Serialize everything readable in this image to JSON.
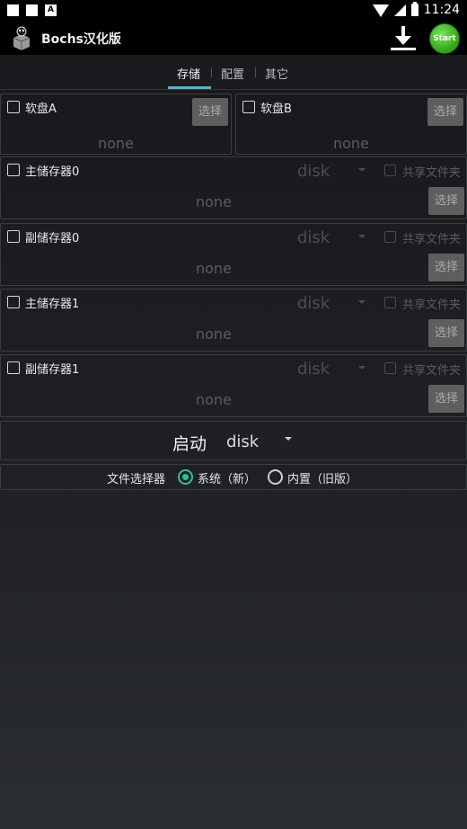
{
  "status_bar": {
    "time": "11:24"
  },
  "app": {
    "title": "Bochs汉化版",
    "start_label": "Start"
  },
  "tabs": [
    {
      "label": "存储",
      "active": true
    },
    {
      "label": "配置",
      "active": false
    },
    {
      "label": "其它",
      "active": false
    }
  ],
  "floppy": [
    {
      "label": "软盘A",
      "value": "none",
      "select_label": "选择"
    },
    {
      "label": "软盘B",
      "value": "none",
      "select_label": "选择"
    }
  ],
  "drives": [
    {
      "label": "主储存器0",
      "type": "disk",
      "share_label": "共享文件夹",
      "value": "none",
      "select_label": "选择"
    },
    {
      "label": "副储存器0",
      "type": "disk",
      "share_label": "共享文件夹",
      "value": "none",
      "select_label": "选择"
    },
    {
      "label": "主储存器1",
      "type": "disk",
      "share_label": "共享文件夹",
      "value": "none",
      "select_label": "选择"
    },
    {
      "label": "副储存器1",
      "type": "disk",
      "share_label": "共享文件夹",
      "value": "none",
      "select_label": "选择"
    }
  ],
  "boot": {
    "label": "启动",
    "value": "disk"
  },
  "file_picker": {
    "label": "文件选择器",
    "options": [
      {
        "label": "系统（新）",
        "selected": true
      },
      {
        "label": "内置（旧版）",
        "selected": false
      }
    ]
  },
  "colors": {
    "accent": "#2fbf9b",
    "tab_indicator": "#5fb0c6",
    "start_button": "#2ea316"
  }
}
